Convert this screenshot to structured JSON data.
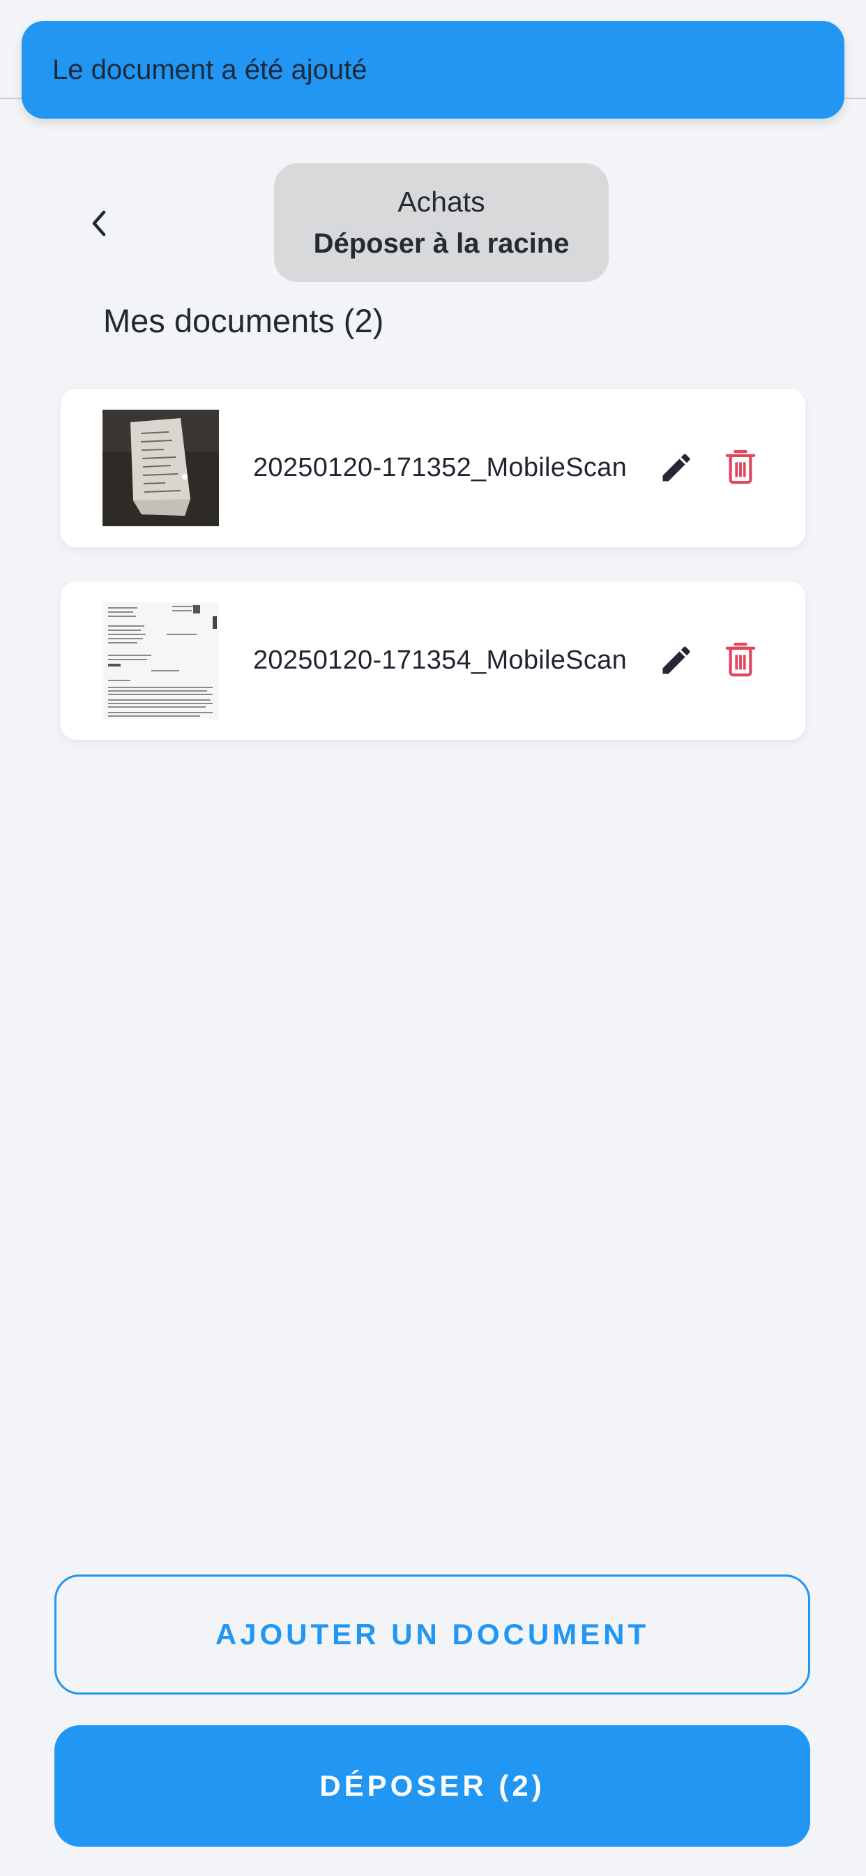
{
  "toast": {
    "message": "Le document a été ajouté"
  },
  "header": {
    "back_icon": "chevron-left-icon",
    "folder_name": "Achats",
    "folder_action": "Déposer à la racine"
  },
  "documents": {
    "title": "Mes documents (2)",
    "items": [
      {
        "name": "20250120-171352_MobileScan",
        "thumbnail": "receipt-photo"
      },
      {
        "name": "20250120-171354_MobileScan",
        "thumbnail": "letter-scan"
      }
    ]
  },
  "actions": {
    "add_label": "AJOUTER UN DOCUMENT",
    "submit_label": "DÉPOSER (2)"
  },
  "colors": {
    "accent": "#2196f3",
    "delete": "#e0475d",
    "background": "#f2f4f7",
    "chip": "#d8d9da"
  }
}
